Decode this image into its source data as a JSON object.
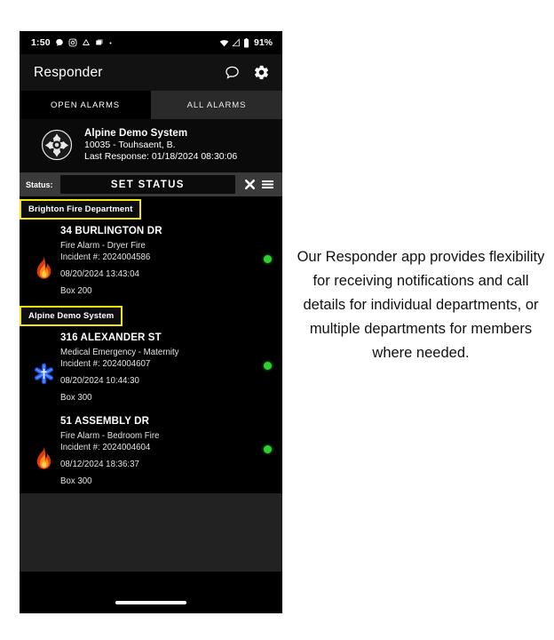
{
  "status_bar": {
    "clock": "1:50",
    "battery_percent": "91%",
    "left_icons": [
      "chat-bubble-icon",
      "instagram-icon",
      "drive-icon",
      "photos-icon",
      "dot-icon"
    ],
    "right_icons": [
      "wifi-icon",
      "signal-icon",
      "battery-icon"
    ]
  },
  "app_bar": {
    "title": "Responder",
    "icons": [
      "message-icon",
      "gear-icon"
    ]
  },
  "tabs": [
    {
      "label": "OPEN ALARMS",
      "active": true
    },
    {
      "label": "ALL ALARMS",
      "active": false
    }
  ],
  "system_header": {
    "emblem": "fire-department-maltese-cross-icon",
    "name": "Alpine Demo System",
    "user": "10035 - Touhsaent, B.",
    "last_response": "Last Response: 01/18/2024 08:30:06"
  },
  "status_row": {
    "label": "Status:",
    "set_status_button": "SET STATUS",
    "clear_icon": "close-x-icon",
    "menu_icon": "hamburger-menu-icon"
  },
  "groups": [
    {
      "department": "Brighton Fire Department",
      "alarms": [
        {
          "address": "34 BURLINGTON DR",
          "type": "Fire Alarm - Dryer Fire",
          "incident": "Incident #: 2024004586",
          "timestamp": "08/20/2024 13:43:04",
          "box": "Box 200",
          "icon": "flame-icon",
          "status_color": "#2fd12f"
        }
      ]
    },
    {
      "department": "Alpine Demo System",
      "alarms": [
        {
          "address": "316 ALEXANDER ST",
          "type": "Medical Emergency - Maternity",
          "incident": "Incident #: 2024004607",
          "timestamp": "08/20/2024 10:44:30",
          "box": "Box 300",
          "icon": "star-of-life-icon",
          "status_color": "#2fd12f"
        },
        {
          "address": "51 ASSEMBLY DR",
          "type": "Fire Alarm - Bedroom Fire",
          "incident": "Incident #: 2024004604",
          "timestamp": "08/12/2024 18:36:37",
          "box": "Box 300",
          "icon": "flame-icon",
          "status_color": "#2fd12f"
        }
      ]
    }
  ],
  "caption": "Our Responder app provides flexibility for receiving notifications and call details for individual departments, or multiple departments for members where needed.",
  "colors": {
    "highlight": "#f2e40f",
    "status_green": "#2fd12f",
    "app_background": "#000000",
    "status_bar_grey": "#3a3a3a"
  },
  "nav_bar": {
    "pill": "gesture-nav-pill"
  }
}
